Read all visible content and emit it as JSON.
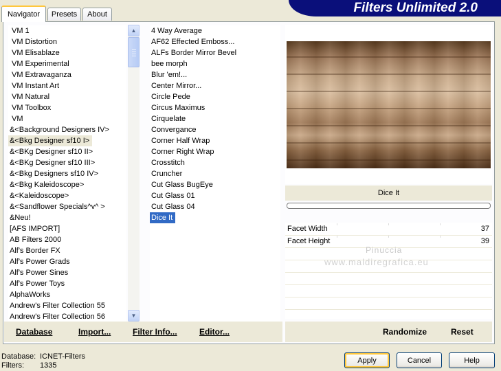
{
  "tabs": [
    "Navigator",
    "Presets",
    "About"
  ],
  "banner": "Filters Unlimited 2.0",
  "categories": [
    "VM 1",
    "VM Distortion",
    "VM Elisablaze",
    "VM Experimental",
    "VM Extravaganza",
    "VM Instant Art",
    "VM Natural",
    "VM Toolbox",
    "VM",
    "&<Background Designers IV>",
    "&<Bkg Designer sf10 I>",
    "&<BKg Designer sf10 II>",
    "&<BKg Designer sf10 III>",
    "&<Bkg Designers sf10 IV>",
    "&<Bkg Kaleidoscope>",
    "&<Kaleidoscope>",
    "&<Sandflower Specials^v^ >",
    "&Neu!",
    "[AFS IMPORT]",
    "AB Filters 2000",
    "Alf's Border FX",
    "Alf's Power Grads",
    "Alf's Power Sines",
    "Alf's Power Toys",
    "AlphaWorks",
    "Andrew's Filter Collection 55",
    "Andrew's Filter Collection 56"
  ],
  "filters": [
    "4 Way Average",
    "AF62 Effected Emboss...",
    "ALFs Border Mirror Bevel",
    "bee morph",
    "Blur 'em!...",
    "Center Mirror...",
    "Circle Pede",
    "Circus Maximus",
    "Cirquelate",
    "Convergance",
    "Corner Half Wrap",
    "Corner Right Wrap",
    "Crosstitch",
    "Cruncher",
    "Cut Glass  BugEye",
    "Cut Glass 01",
    "Cut Glass 04",
    "Dice It"
  ],
  "selected_filter": "Dice It",
  "params": [
    {
      "label": "Facet Width",
      "value": "37"
    },
    {
      "label": "Facet Height",
      "value": "39"
    }
  ],
  "watermark": {
    "line1": "Pinuccia",
    "line2": "www.maldiregrafica.eu"
  },
  "toolbar": {
    "database": "Database",
    "import": "Import...",
    "filter_info": "Filter Info...",
    "editor": "Editor...",
    "randomize": "Randomize",
    "reset": "Reset"
  },
  "status": {
    "database_label": "Database:",
    "database_value": "ICNET-Filters",
    "filters_label": "Filters:",
    "filters_value": "1335"
  },
  "dialog_buttons": {
    "apply": "Apply",
    "cancel": "Cancel",
    "help": "Help"
  }
}
